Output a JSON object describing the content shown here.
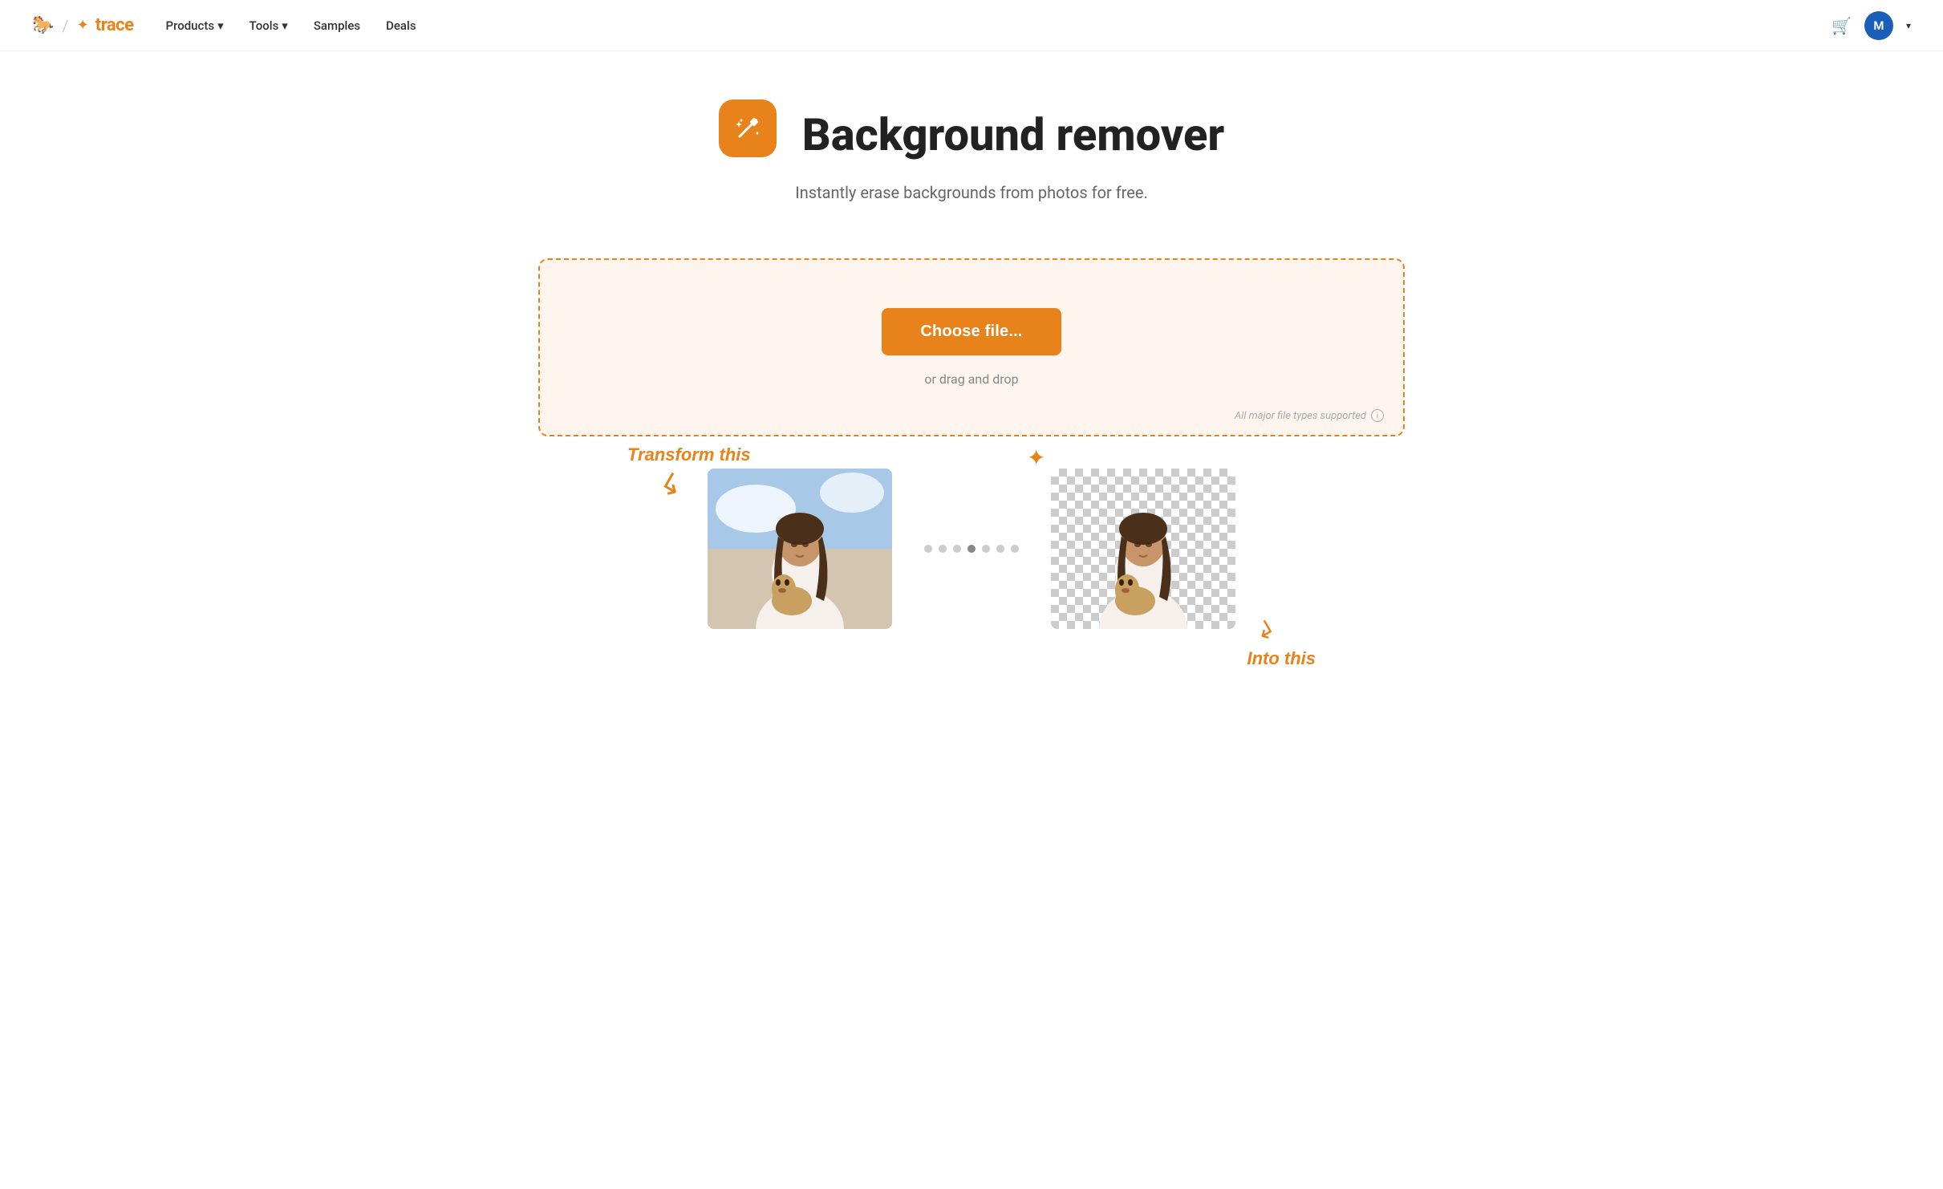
{
  "nav": {
    "logo_text": "trace",
    "links": [
      {
        "label": "Products",
        "has_dropdown": true
      },
      {
        "label": "Tools",
        "has_dropdown": true
      },
      {
        "label": "Samples",
        "has_dropdown": false
      },
      {
        "label": "Deals",
        "has_dropdown": false
      }
    ],
    "cart_icon": "cart-icon",
    "avatar_letter": "M",
    "avatar_has_dropdown": true
  },
  "hero": {
    "icon_alt": "magic-wand-icon",
    "title": "Background remover",
    "subtitle": "Instantly erase backgrounds from photos for free."
  },
  "upload": {
    "choose_file_label": "Choose file...",
    "drag_drop_label": "or drag and drop",
    "file_types_note": "All major file types supported"
  },
  "demo": {
    "transform_label": "Transform this",
    "into_label": "Into this",
    "dots": [
      {
        "active": false
      },
      {
        "active": false
      },
      {
        "active": false
      },
      {
        "active": true
      },
      {
        "active": false
      },
      {
        "active": false
      },
      {
        "active": false
      }
    ]
  },
  "colors": {
    "primary": "#E8821A",
    "avatar_bg": "#1a5eb8"
  }
}
